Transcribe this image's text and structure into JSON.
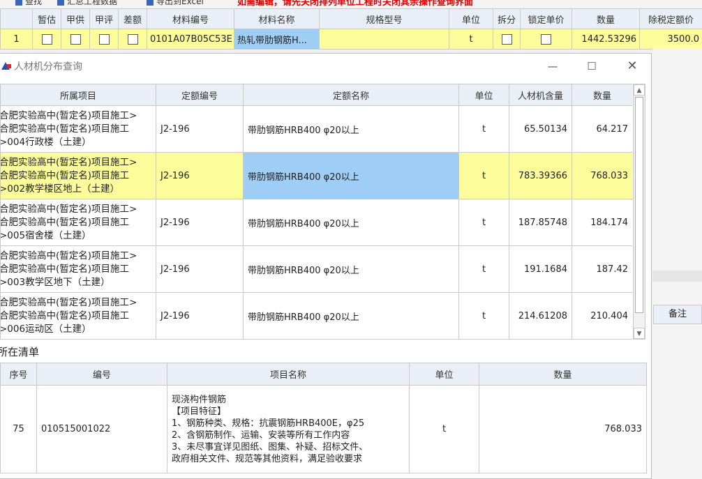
{
  "background": {
    "toolbar_fragments": [
      "查找",
      "汇总工程数据",
      "导出到Excel"
    ],
    "toolbar_red_text": "如需编辑，请先关闭排列单位工程时关闭其余操作查询界面",
    "grid_headers": [
      "",
      "暂估",
      "甲供",
      "甲评",
      "差额",
      "材料编号",
      "材料名称",
      "规格型号",
      "单位",
      "拆分",
      "锁定单价",
      "数量",
      "除税定额价"
    ],
    "grid_row": {
      "index": "1",
      "code": "0101A07B05C53E",
      "name": "热轧带肋钢筋H...",
      "spec": "",
      "unit": "t",
      "quantity": "1442.53296",
      "price": "3500.0"
    },
    "remark_header": "备注"
  },
  "dialog": {
    "title": "人材机分布查询",
    "distribution": {
      "headers": [
        "所属项目",
        "定额编号",
        "定额名称",
        "单位",
        "人材机含量",
        "数量"
      ],
      "rows": [
        {
          "project": "合肥实验高中(暂定名)项目施工>\n合肥实验高中(暂定名)项目施工\n>004行政楼（土建）",
          "code": "J2-196",
          "name": "带肋钢筋HRB400 φ20以上",
          "unit": "t",
          "content": "65.50134",
          "qty": "64.217"
        },
        {
          "project": "合肥实验高中(暂定名)项目施工>\n合肥实验高中(暂定名)项目施工\n>002教学楼区地上（土建）",
          "code": "J2-196",
          "name": "带肋钢筋HRB400 φ20以上",
          "unit": "t",
          "content": "783.39366",
          "qty": "768.033"
        },
        {
          "project": "合肥实验高中(暂定名)项目施工>\n合肥实验高中(暂定名)项目施工\n>005宿舍楼（土建）",
          "code": "J2-196",
          "name": "带肋钢筋HRB400 φ20以上",
          "unit": "t",
          "content": "187.85748",
          "qty": "184.174"
        },
        {
          "project": "合肥实验高中(暂定名)项目施工>\n合肥实验高中(暂定名)项目施工\n>003教学区地下（土建）",
          "code": "J2-196",
          "name": "带肋钢筋HRB400 φ20以上",
          "unit": "t",
          "content": "191.1684",
          "qty": "187.42"
        },
        {
          "project": "合肥实验高中(暂定名)项目施工>\n合肥实验高中(暂定名)项目施工\n>006运动区（土建）",
          "code": "J2-196",
          "name": "带肋钢筋HRB400 φ20以上",
          "unit": "t",
          "content": "214.61208",
          "qty": "210.404"
        }
      ]
    },
    "list_section_label": "所在清单",
    "list": {
      "headers": [
        "序号",
        "编号",
        "项目名称",
        "单位",
        "数量"
      ],
      "row": {
        "seq": "75",
        "code": "010515001022",
        "name": "现浇构件钢筋\n【项目特征】\n1、钢筋种类、规格：抗震钢筋HRB400E，φ25\n2、含钢筋制作、运输、安装等所有工作内容\n3、未尽事宜详见图纸、图集、补疑、招标文件、\n政府相关文件、规范等其他资料，满足验收要求",
        "unit": "t",
        "qty": "768.033"
      }
    }
  },
  "colors": {
    "highlight_row": "#fdfd9c",
    "selected_cell": "#9ecdf5",
    "header_bg": "#e9eef7"
  }
}
